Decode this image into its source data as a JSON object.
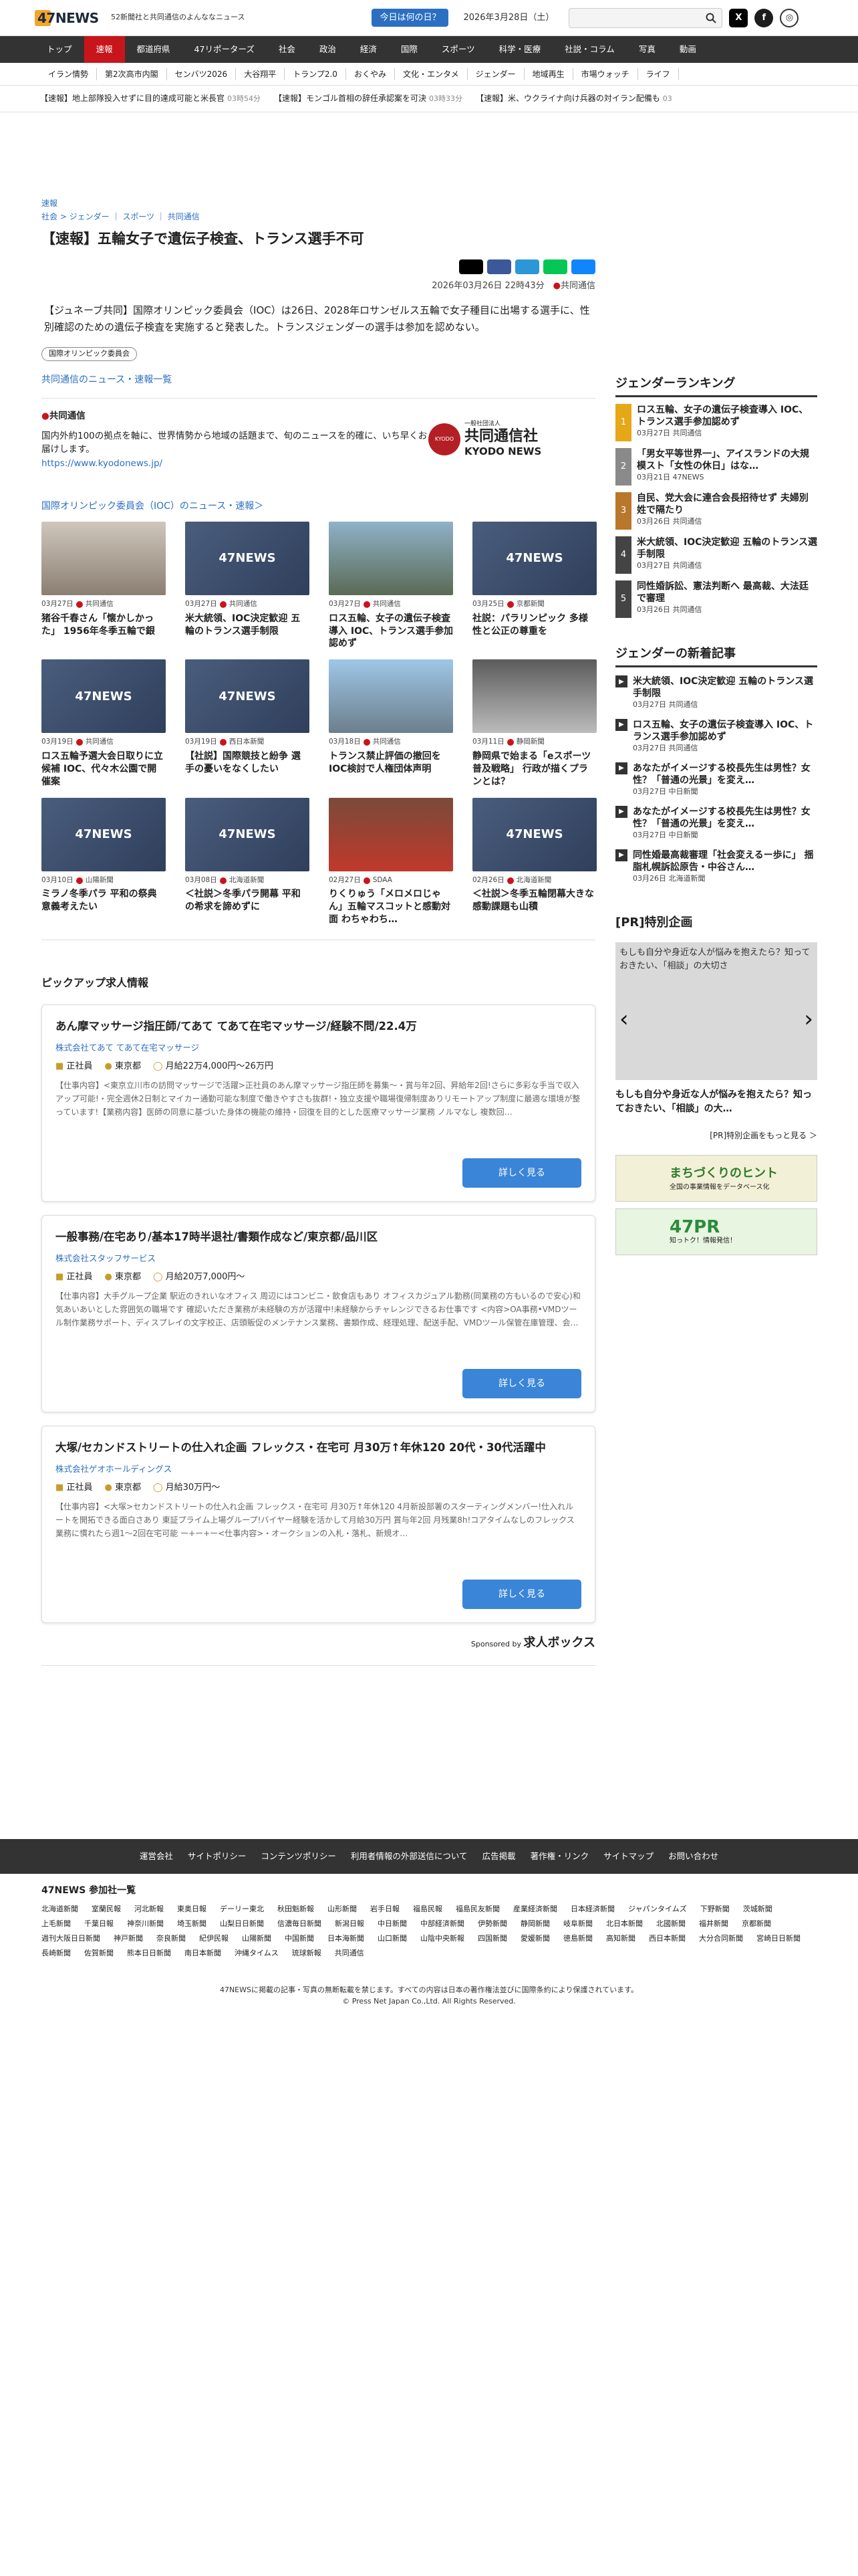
{
  "header": {
    "logo": "47NEWS",
    "tagline": "52新聞社と共同通信のよんななニュース",
    "today": "今日は何の日？",
    "date": "2026年3月28日（土）"
  },
  "nav": [
    "トップ",
    "速報",
    "都道府県",
    "47リポーターズ",
    "社会",
    "政治",
    "経済",
    "国際",
    "スポーツ",
    "科学・医療",
    "社説・コラム",
    "写真",
    "動画"
  ],
  "subnav": [
    "イラン情勢",
    "第2次高市内閣",
    "センバツ2026",
    "大谷翔平",
    "トランプ2.0",
    "おくやみ",
    "文化・エンタメ",
    "ジェンダー",
    "地域再生",
    "市場ウォッチ",
    "ライフ"
  ],
  "ticker": [
    {
      "t": "【速報】地上部隊投入せずに目的達成可能と米長官",
      "m": "03時54分"
    },
    {
      "t": "【速報】モンゴル首相の辞任承認案を可決",
      "m": "03時33分"
    },
    {
      "t": "【速報】米、ウクライナ向け兵器の対イラン配備も",
      "m": "03"
    }
  ],
  "article": {
    "flash": "速報",
    "crumb": "社会 > ジェンダー ｜ スポーツ ｜ 共同通信",
    "title": "【速報】五輪女子で遺伝子検査、トランス選手不可",
    "meta": "2026年03月26日 22時43分",
    "source": "共同通信",
    "lead": "【ジュネーブ共同】国際オリンピック委員会（IOC）は26日、2028年ロサンゼルス五輪で女子種目に出場する選手に、性別確認のための遺伝子検査を実施すると発表した。トランスジェンダーの選手は参加を認めない。",
    "tag": "国際オリンピック委員会",
    "kyodo_link": "共同通信のニュース・速報一覧",
    "kyodo_name": "共同通信",
    "kyodo_desc": "国内外約100の拠点を軸に、世界情勢から地域の話題まで、旬のニュースを的確に、いち早くお届けします。",
    "kyodo_url": "https://www.kyodonews.jp/",
    "kyodo_logo_sub": "一般社団法人",
    "kyodo_logo": "共同通信社",
    "kyodo_logo_en": "KYODO NEWS"
  },
  "ioc": {
    "heading": "国際オリンピック委員会（IOC）のニュース・速報＞",
    "cards": [
      {
        "date": "03月27日",
        "src": "共同通信",
        "title": "猪谷千春さん「懐かしかった」 1956年冬季五輪で銀",
        "img": "photo"
      },
      {
        "date": "03月27日",
        "src": "共同通信",
        "title": "米大統領、IOC決定歓迎 五輪のトランス選手制限",
        "img": "47"
      },
      {
        "date": "03月27日",
        "src": "共同通信",
        "title": "ロス五輪、女子の遺伝子検査導入 IOC、トランス選手参加認めず",
        "img": "rings"
      },
      {
        "date": "03月25日",
        "src": "京都新聞",
        "title": "社説：パラリンピック 多様性と公正の尊重を",
        "img": "47"
      },
      {
        "date": "03月19日",
        "src": "共同通信",
        "title": "ロス五輪予選大会日取りに立候補 IOC、代々木公園で開催案",
        "img": "47"
      },
      {
        "date": "03月19日",
        "src": "西日本新聞",
        "title": "【社説】国際競技と紛争 選手の憂いをなくしたい",
        "img": "47"
      },
      {
        "date": "03月18日",
        "src": "共同通信",
        "title": "トランス禁止評価の撤回を IOC検討で人権団体声明",
        "img": "stadium"
      },
      {
        "date": "03月11日",
        "src": "静岡新聞",
        "title": "静岡県で始まる「eスポーツ普及戦略」 行政が描くプランとは？",
        "img": "game"
      },
      {
        "date": "03月10日",
        "src": "山陽新聞",
        "title": "ミラノ冬季パラ 平和の祭典 意義考えたい",
        "img": "47"
      },
      {
        "date": "03月08日",
        "src": "北海道新聞",
        "title": "＜社説＞冬季パラ開幕 平和の希求を諦めずに",
        "img": "47"
      },
      {
        "date": "02月27日",
        "src": "SDAA",
        "title": "りくりゅう「メロメロじゃん」五輪マスコットと感動対面 わちゃわち…",
        "img": "people"
      },
      {
        "date": "02月26日",
        "src": "北海道新聞",
        "title": "＜社説＞冬季五輪閉幕大きな感動課題も山積",
        "img": "47"
      }
    ]
  },
  "jobs": {
    "heading": "ピックアップ求人情報",
    "button": "詳しく見る",
    "sponsor": "Sponsored by",
    "sponsor_name": "求人ボックス",
    "items": [
      {
        "title": "あん摩マッサージ指圧師/てあて てあて在宅マッサージ/経験不問/22.4万",
        "company": "株式会社てあて てあて在宅マッサージ",
        "type": "正社員",
        "loc": "東京都",
        "pay": "月給22万4,000円〜26万円",
        "desc": "【仕事内容】<東京立川市の訪問マッサージで活躍>正社員のあん摩マッサージ指圧師を募集～・賞与年2回、昇給年2回!さらに多彩な手当で収入アップ可能!・完全週休2日制とマイカー通勤可能な制度で働きやすさも抜群!・独立支援や職場復帰制度ありリモートアップ制度に最適な環境が整っています!【業務内容】医師の同意に基づいた身体の機能の維持・回復を目的とした医療マッサージ業務 ノルマなし 複数回…"
      },
      {
        "title": "一般事務/在宅あり/基本17時半退社/書類作成など/東京都/品川区",
        "company": "株式会社スタッフサービス",
        "type": "正社員",
        "loc": "東京都",
        "pay": "月給20万7,000円〜",
        "desc": "【仕事内容】大手グループ企業 駅近のきれいなオフィス 周辺にはコンビニ・飲食店もあり オフィスカジュアル勤務(同業務の方もいるので安心)和気あいあいとした雰囲気の職場です 確認いただき業務が未経験の方が活躍中!未経験からチャレンジできるお仕事です <内容>OA事務•VMDツール制作業務サポート、ディスプレイの文字校正、店頭販促のメンテナンス業務、書類作成、経理処理、配送手配、VMDツール保管在庫管理、会…"
      },
      {
        "title": "大塚/セカンドストリートの仕入れ企画 フレックス・在宅可 月30万↑年休120 20代・30代活躍中",
        "company": "株式会社ゲオホールディングス",
        "type": "正社員",
        "loc": "東京都",
        "pay": "月給30万円〜",
        "desc": "【仕事内容】<大塚>セカンドストリートの仕入れ企画 フレックス・在宅可 月30万↑年休120 4月新設部署のスターティングメンバー!仕入れルートを開拓できる面白さあり 東証プライム上場グループ!バイヤー経験を活かして月給30万円 賞与年2回 月残業8h!コアタイムなしのフレックス 業務に慣れたら週1〜2回在宅可能 ー+ー+ー<仕事内容>・オークションの入札・落札、新規オ…"
      }
    ]
  },
  "side": {
    "rank_head": "ジェンダーランキング",
    "rank": [
      {
        "n": "1",
        "t": "ロス五輪、女子の遺伝子検査導入 IOC、トランス選手参加認めず",
        "d": "03月27日",
        "s": "共同通信"
      },
      {
        "n": "2",
        "t": "「男女平等世界一」、アイスランドの大規模スト「女性の休日」はな…",
        "d": "03月21日",
        "s": "47NEWS"
      },
      {
        "n": "3",
        "t": "自民、党大会に連合会長招待せず 夫婦別姓で隔たり",
        "d": "03月26日",
        "s": "共同通信"
      },
      {
        "n": "4",
        "t": "米大統領、IOC決定歓迎 五輪のトランス選手制限",
        "d": "03月27日",
        "s": "共同通信"
      },
      {
        "n": "5",
        "t": "同性婚訴訟、憲法判断へ 最高裁、大法廷で審理",
        "d": "03月26日",
        "s": "共同通信"
      }
    ],
    "new_head": "ジェンダーの新着記事",
    "new": [
      {
        "t": "米大統領、IOC決定歓迎 五輪のトランス選手制限",
        "d": "03月27日",
        "s": "共同通信"
      },
      {
        "t": "ロス五輪、女子の遺伝子検査導入 IOC、トランス選手参加認めず",
        "d": "03月27日",
        "s": "共同通信"
      },
      {
        "t": "あなたがイメージする校長先生は男性？女性？「普通の光景」を変え…",
        "d": "03月27日",
        "s": "中日新聞"
      },
      {
        "t": "あなたがイメージする校長先生は男性？女性？「普通の光景」を変え…",
        "d": "03月27日",
        "s": "中日新聞"
      },
      {
        "t": "同性婚最高裁審理「社会変えるー歩に」 揺脂札幌訴訟原告・中谷さん…",
        "d": "03月26日",
        "s": "北海道新聞"
      }
    ],
    "pr_head": "[PR]特別企画",
    "pr_img": "もしも自分や身近な人が悩みを抱えたら？知っておきたい、「相談」の大切さ",
    "pr_title": "もしも自分や身近な人が悩みを抱えたら？知っておきたい、「相談」の大…",
    "pr_more": "[PR]特別企画をもっと見る ＞",
    "banner1": "まちづくりのヒント",
    "banner1_sub": "全国の事業情報をデータベース化",
    "banner2": "47PR",
    "banner2_sub": "知っトク！情報発信！"
  },
  "footer": {
    "links": [
      "運営会社",
      "サイトポリシー",
      "コンテンツポリシー",
      "利用者情報の外部送信について",
      "広告掲載",
      "著作権・リンク",
      "サイトマップ",
      "お問い合わせ"
    ],
    "members_head": "47NEWS 参加社一覧",
    "members": [
      "北海道新聞",
      "室蘭民報",
      "河北新報",
      "東奥日報",
      "デーリー東北",
      "秋田魁新報",
      "山形新聞",
      "岩手日報",
      "福島民報",
      "福島民友新聞",
      "産業経済新聞",
      "日本経済新聞",
      "ジャパンタイムズ",
      "下野新聞",
      "茨城新聞",
      "上毛新聞",
      "千葉日報",
      "神奈川新聞",
      "埼玉新聞",
      "山梨日日新聞",
      "信濃毎日新聞",
      "新潟日報",
      "中日新聞",
      "中部経済新聞",
      "伊勢新聞",
      "静岡新聞",
      "岐阜新聞",
      "北日本新聞",
      "北國新聞",
      "福井新聞",
      "京都新聞",
      "週刊大阪日日新聞",
      "神戸新聞",
      "奈良新聞",
      "紀伊民報",
      "山陽新聞",
      "中国新聞",
      "日本海新聞",
      "山口新聞",
      "山陰中央新報",
      "四国新聞",
      "愛媛新聞",
      "徳島新聞",
      "高知新聞",
      "西日本新聞",
      "大分合同新聞",
      "宮崎日日新聞",
      "長崎新聞",
      "佐賀新聞",
      "熊本日日新聞",
      "南日本新聞",
      "沖縄タイムス",
      "琉球新報",
      "共同通信"
    ],
    "copy1": "47NEWSに掲載の記事・写真の無断転載を禁じます。すべての内容は日本の著作権法並びに国際条約により保護されています。",
    "copy2": "© Press Net Japan Co.,Ltd. All Rights Reserved."
  }
}
